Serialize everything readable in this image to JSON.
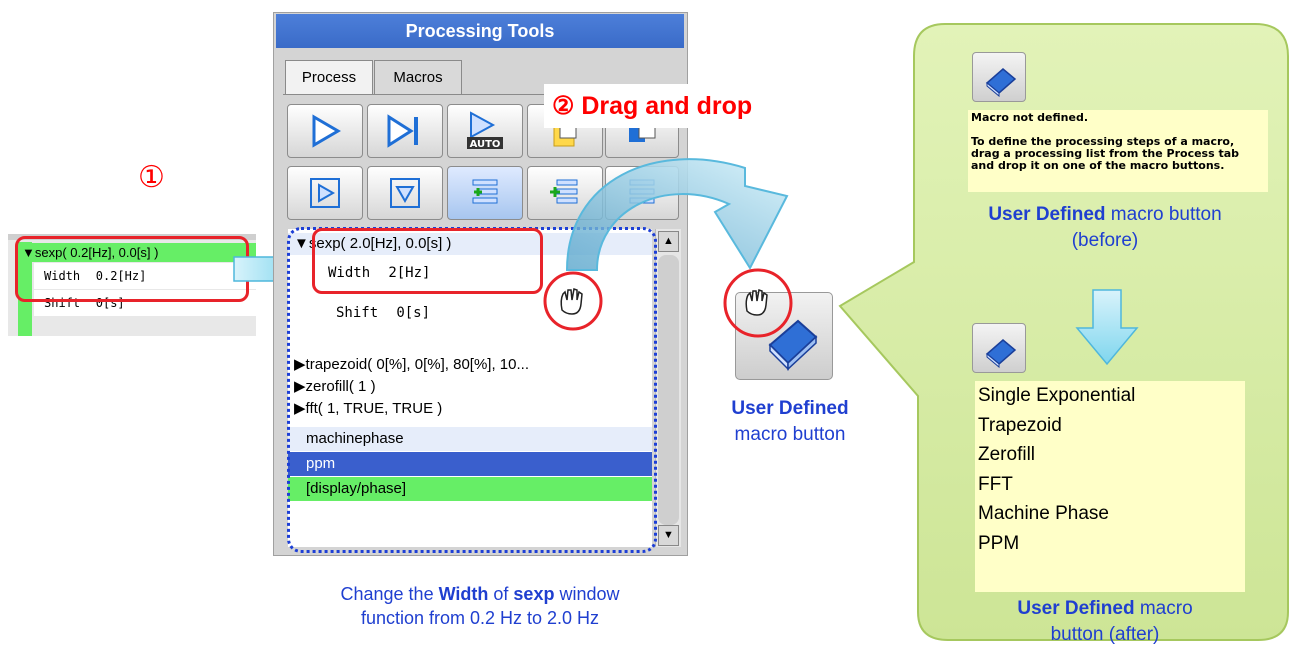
{
  "step1": {
    "label": "①"
  },
  "snippet": {
    "row1": "▼sexp( 0.2[Hz], 0.0[s] )",
    "row2_name": "Width",
    "row2_value": "0.2[Hz]",
    "row3_name": "Shift",
    "row3_value": "0[s]"
  },
  "panel": {
    "title": "Processing Tools",
    "tabs": [
      "Process",
      "Macros"
    ],
    "list": {
      "sexp": "sexp( 2.0[Hz], 0.0[s] )",
      "width_name": "Width",
      "width_value": "2[Hz]",
      "shift_name": "Shift",
      "shift_value": "0[s]",
      "trapezoid": "trapezoid( 0[%], 0[%], 80[%], 10...",
      "zerofill": "zerofill( 1 )",
      "fft": "fft( 1, TRUE, TRUE )",
      "machinephase": "machinephase",
      "ppm": "ppm",
      "display": "[display/phase]"
    }
  },
  "drag_label": "② Drag and drop",
  "middle_button": {
    "label_bold": "User Defined",
    "label_rest": "macro button"
  },
  "caption": {
    "part1": "Change the ",
    "bold1": "Width",
    "part2": " of ",
    "bold2": "sexp",
    "part3": " window",
    "line2": "function from 0.2 Hz to 2.0 Hz"
  },
  "before": {
    "note_lines": [
      "Macro not defined.",
      "",
      "To define the processing steps of a macro,",
      "drag a processing list from the Process tab",
      "and drop it on one of the macro buttons."
    ],
    "label_bold": "User Defined",
    "label_rest": " macro button",
    "label_line2": "(before)"
  },
  "after": {
    "items": [
      "Single Exponential",
      "Trapezoid",
      "Zerofill",
      "FFT",
      "Machine Phase",
      "PPM"
    ],
    "label_bold": "User Defined",
    "label_rest": " macro",
    "label_line2": "button (after)"
  },
  "colors": {
    "accent_blue": "#1f3fd0",
    "red": "#e8232a",
    "green_row": "#66ee66",
    "selected_row": "#3a5fcd",
    "callout": "#d2ec9c"
  }
}
